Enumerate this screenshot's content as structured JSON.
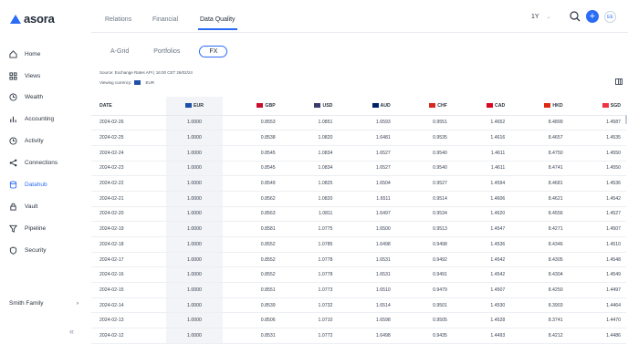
{
  "app": {
    "logo_text": "asora"
  },
  "sidebar": {
    "items": [
      {
        "label": "Home",
        "icon": "home-icon"
      },
      {
        "label": "Views",
        "icon": "grid-icon"
      },
      {
        "label": "Wealth",
        "icon": "clock-icon"
      },
      {
        "label": "Accounting",
        "icon": "bar-chart-icon"
      },
      {
        "label": "Activity",
        "icon": "clock-icon"
      },
      {
        "label": "Connections",
        "icon": "share-icon"
      },
      {
        "label": "Datahub",
        "icon": "database-icon"
      },
      {
        "label": "Vault",
        "icon": "lock-icon"
      },
      {
        "label": "Pipeline",
        "icon": "filter-icon"
      },
      {
        "label": "Security",
        "icon": "shield-icon"
      }
    ],
    "active": "Datahub",
    "account_label": "Smith Family",
    "account_chevron": "›",
    "collapse_glyph": "«"
  },
  "topbar": {
    "tabs": [
      "Relations",
      "Financial",
      "Data Quality"
    ],
    "active_tab": "Data Quality",
    "period": "1Y",
    "period_chevron": "⌄",
    "plus_glyph": "+",
    "avatar_initials": "EE"
  },
  "subtabs": {
    "items": [
      "A-Grid",
      "Portfolios",
      "FX"
    ],
    "active": "FX"
  },
  "info": {
    "source": "Source: Exchange Rates API | 16:00 CET 26/02/24",
    "viewing_currency_label": "Viewing currency:",
    "viewing_currency": "EUR"
  },
  "table": {
    "headers": [
      "DATE",
      "EUR",
      "GBP",
      "USD",
      "AUD",
      "CHF",
      "CAD",
      "HKD",
      "SGD"
    ],
    "rows": [
      [
        "2024-02-26",
        "1.0000",
        "0.8553",
        "1.0851",
        "1.6593",
        "0.9551",
        "1.4652",
        "8.4899",
        "1.4587"
      ],
      [
        "2024-02-25",
        "1.0000",
        "0.8538",
        "1.0820",
        "1.6481",
        "0.9535",
        "1.4616",
        "8.4657",
        "1.4535"
      ],
      [
        "2024-02-24",
        "1.0000",
        "0.8545",
        "1.0834",
        "1.6527",
        "0.9540",
        "1.4611",
        "8.4750",
        "1.4550"
      ],
      [
        "2024-02-23",
        "1.0000",
        "0.8545",
        "1.0834",
        "1.6527",
        "0.9540",
        "1.4611",
        "8.4741",
        "1.4550"
      ],
      [
        "2024-02-22",
        "1.0000",
        "0.8549",
        "1.0825",
        "1.6504",
        "0.9527",
        "1.4594",
        "8.4681",
        "1.4536"
      ],
      [
        "2024-02-21",
        "1.0000",
        "0.8562",
        "1.0820",
        "1.6511",
        "0.9514",
        "1.4606",
        "8.4621",
        "1.4542"
      ],
      [
        "2024-02-20",
        "1.0000",
        "0.8563",
        "1.0811",
        "1.6497",
        "0.9534",
        "1.4620",
        "8.4556",
        "1.4527"
      ],
      [
        "2024-02-19",
        "1.0000",
        "0.8581",
        "1.0775",
        "1.6500",
        "0.9513",
        "1.4547",
        "8.4271",
        "1.4507"
      ],
      [
        "2024-02-18",
        "1.0000",
        "0.8552",
        "1.0785",
        "1.6498",
        "0.9498",
        "1.4536",
        "8.4346",
        "1.4510"
      ],
      [
        "2024-02-17",
        "1.0000",
        "0.8552",
        "1.0778",
        "1.6531",
        "0.9492",
        "1.4542",
        "8.4305",
        "1.4548"
      ],
      [
        "2024-02-16",
        "1.0000",
        "0.8552",
        "1.0778",
        "1.6531",
        "0.9491",
        "1.4542",
        "8.4304",
        "1.4549"
      ],
      [
        "2024-02-15",
        "1.0000",
        "0.8551",
        "1.0773",
        "1.6510",
        "0.9479",
        "1.4507",
        "8.4250",
        "1.4497"
      ],
      [
        "2024-02-14",
        "1.0000",
        "0.8539",
        "1.0732",
        "1.6514",
        "0.9501",
        "1.4530",
        "8.3903",
        "1.4464"
      ],
      [
        "2024-02-13",
        "1.0000",
        "0.8506",
        "1.0710",
        "1.6598",
        "0.9505",
        "1.4528",
        "8.3741",
        "1.4470"
      ],
      [
        "2024-02-12",
        "1.0000",
        "0.8531",
        "1.0772",
        "1.6498",
        "0.9435",
        "1.4493",
        "8.4212",
        "1.4486"
      ]
    ]
  },
  "flag_colors": {
    "EUR": "#1f4fa8",
    "GBP": "#c8102e",
    "USD": "#3c3b6e",
    "AUD": "#012169",
    "CHF": "#d52b1e",
    "CAD": "#d80621",
    "HKD": "#de2910",
    "SGD": "#ef3340"
  }
}
